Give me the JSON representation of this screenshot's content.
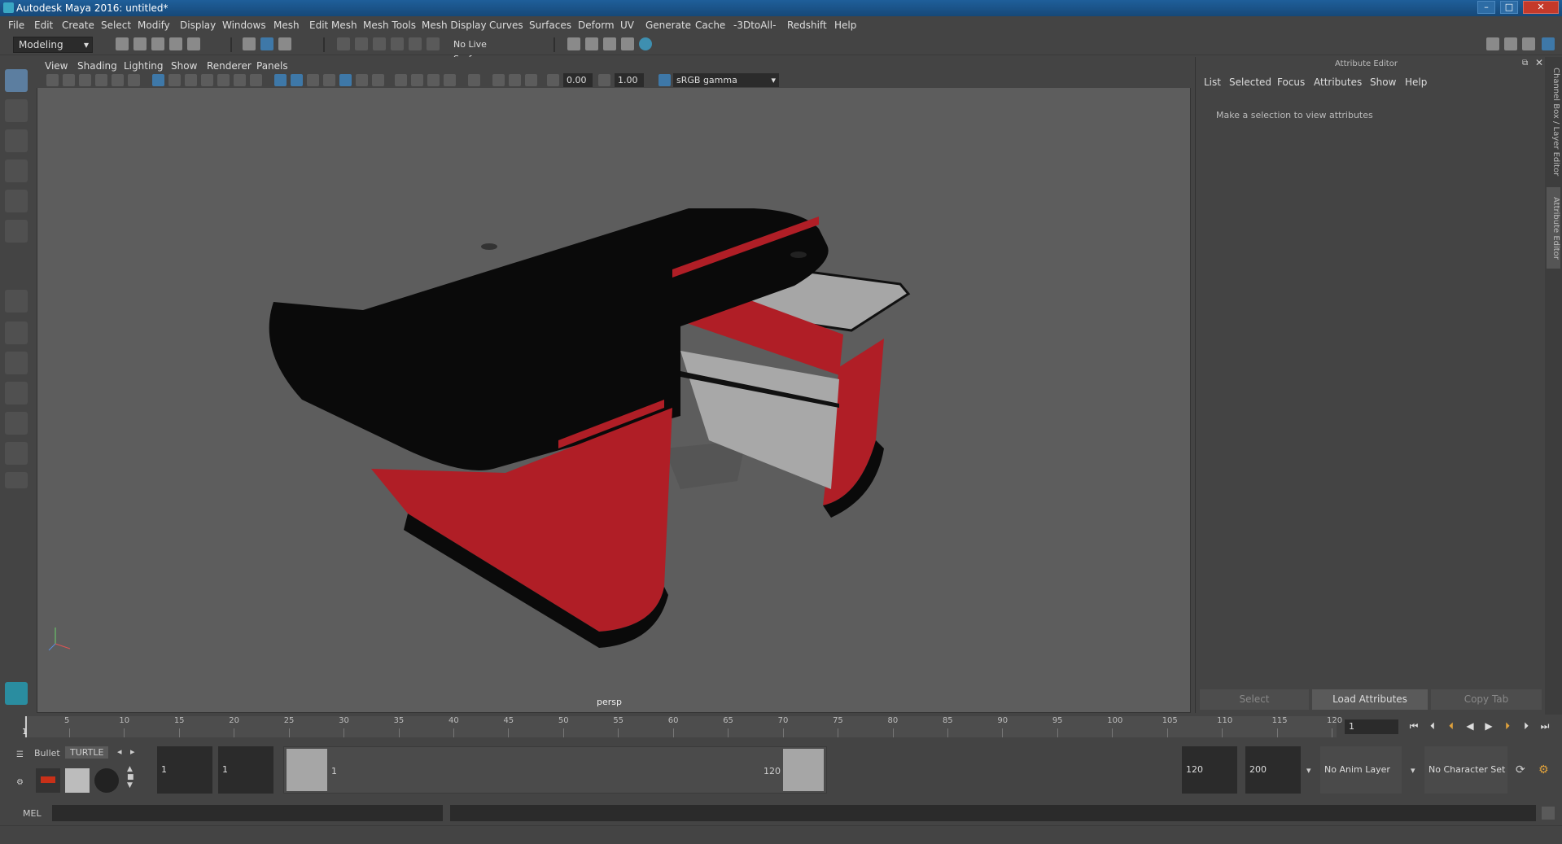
{
  "window": {
    "title": "Autodesk Maya 2016: untitled*"
  },
  "menu": [
    "File",
    "Edit",
    "Create",
    "Select",
    "Modify",
    "Display",
    "Windows",
    "Mesh",
    "Edit Mesh",
    "Mesh Tools",
    "Mesh Display",
    "Curves",
    "Surfaces",
    "Deform",
    "UV",
    "Generate",
    "Cache",
    "-3DtoAll-",
    "Redshift",
    "Help"
  ],
  "status": {
    "workspace": "Modeling",
    "live_surface": "No Live Surface"
  },
  "panel_menu": [
    "View",
    "Shading",
    "Lighting",
    "Show",
    "Renderer",
    "Panels"
  ],
  "viewport": {
    "exposure": "0.00",
    "gamma": "1.00",
    "color_space": "sRGB gamma",
    "camera": "persp"
  },
  "attribute_editor": {
    "title": "Attribute Editor",
    "menu": [
      "List",
      "Selected",
      "Focus",
      "Attributes",
      "Show",
      "Help"
    ],
    "message": "Make a selection to view attributes",
    "buttons": {
      "select": "Select",
      "load": "Load Attributes",
      "copy": "Copy Tab"
    }
  },
  "side_tabs": {
    "channel_box": "Channel Box / Layer Editor",
    "attr_editor": "Attribute Editor"
  },
  "timeline": {
    "ticks": [
      "1",
      "5",
      "10",
      "15",
      "20",
      "25",
      "30",
      "35",
      "40",
      "45",
      "50",
      "55",
      "60",
      "65",
      "70",
      "75",
      "80",
      "85",
      "90",
      "95",
      "100",
      "105",
      "110",
      "115",
      "120"
    ],
    "current_frame": "1"
  },
  "range": {
    "start": "1",
    "anim_start": "1",
    "range_start_label": "1",
    "range_end_label": "120",
    "anim_end": "120",
    "end": "200",
    "anim_layer": "No Anim Layer",
    "character_set": "No Character Set"
  },
  "shelf": {
    "tab_bullet": "Bullet",
    "tab_turtle": "TURTLE"
  },
  "command": {
    "language": "MEL"
  },
  "colors": {
    "counter_red": "#b01e26",
    "counter_black": "#0a0a0a",
    "viewport_bg": "#5d5d5d"
  }
}
